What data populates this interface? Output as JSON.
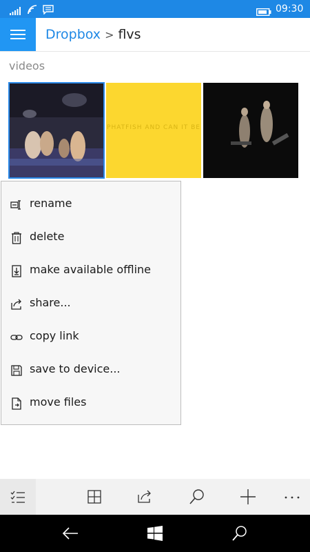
{
  "status": {
    "time": "09:30"
  },
  "header": {
    "breadcrumb_root": "Dropbox",
    "breadcrumb_current": "flvs"
  },
  "section": {
    "label": "videos"
  },
  "thumbnails": [
    {
      "caption": ""
    },
    {
      "caption": "PHATFISH    AND CAN IT BE"
    },
    {
      "caption": ""
    }
  ],
  "menu": {
    "items": [
      {
        "label": "rename",
        "icon": "rename-icon"
      },
      {
        "label": "delete",
        "icon": "trash-icon"
      },
      {
        "label": "make available offline",
        "icon": "offline-icon"
      },
      {
        "label": "share...",
        "icon": "share-icon"
      },
      {
        "label": "copy link",
        "icon": "link-icon"
      },
      {
        "label": "save to device...",
        "icon": "save-icon"
      },
      {
        "label": "move files",
        "icon": "move-file-icon"
      }
    ]
  },
  "appbar": {
    "icons": [
      "select-list-icon",
      "grid-view-icon",
      "share-icon",
      "search-icon",
      "add-icon",
      "more-icon"
    ]
  },
  "navbar": {
    "icons": [
      "back-arrow-icon",
      "windows-start-icon",
      "search-icon"
    ]
  },
  "colors": {
    "accent": "#1e88e5",
    "hamburger_bg": "#2196f3",
    "menu_bg": "#f7f7f7"
  }
}
